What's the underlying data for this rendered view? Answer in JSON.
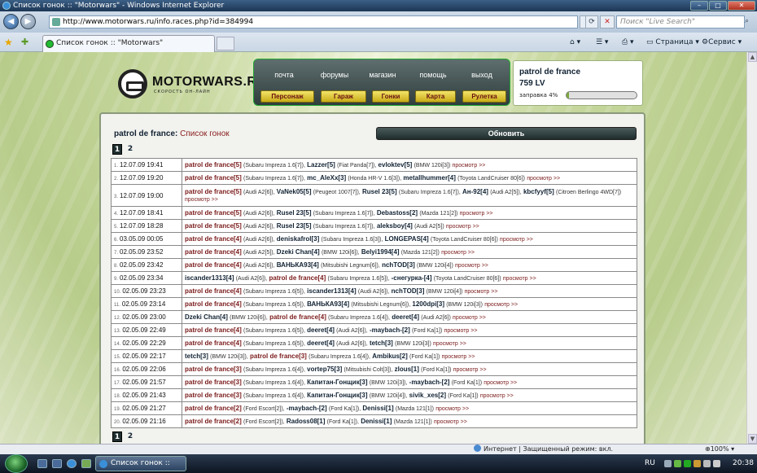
{
  "browser": {
    "window_title": "Список гонок :: \"Motorwars\" - Windows Internet Explorer",
    "url": "http://www.motorwars.ru/info.races.php?id=384994",
    "search_placeholder": "Поиск \"Live Search\"",
    "tab_title": "Список гонок :: \"Motorwars\"",
    "tool_page": "Страница",
    "tool_service": "Сервис",
    "status_zone": "Интернет | Защищенный режим: вкл.",
    "zoom": "100%"
  },
  "taskbar": {
    "task_label": "Список гонок :: \"М...",
    "lang": "RU",
    "clock": "20:38"
  },
  "site": {
    "logo_name": "MOTORWARS.RU",
    "logo_slogan": "СКОРОСТЬ ОН-ЛАЙН",
    "nav_top": [
      "почта",
      "форумы",
      "магазин",
      "помощь",
      "выход"
    ],
    "nav_buttons": [
      "Персонаж",
      "Гараж",
      "Гонки",
      "Карта",
      "Рулетка"
    ],
    "user_name": "patrol de france",
    "user_money": "759 LV",
    "fuel_label": "заправка 4%",
    "fuel_percent": 4,
    "crumb_user": "patrol de france:",
    "crumb_link": "Список гонок",
    "refresh_label": "Обновить",
    "pages": [
      "1",
      "2"
    ],
    "current_page": "1"
  },
  "races": [
    {
      "n": "1.",
      "date": "12.07.09 19:41",
      "p": [
        [
          "patrol de france[5]",
          "(Subaru Impreza 1.6[7]),"
        ],
        [
          "Lazzer[5]",
          "(Fiat Panda[7]),"
        ],
        [
          "evloktev[5]",
          "(BMW 120i[3])"
        ]
      ],
      "view": "просмотр >>"
    },
    {
      "n": "2.",
      "date": "12.07.09 19:20",
      "p": [
        [
          "patrol de france[5]",
          "(Subaru Impreza 1.6[7]),"
        ],
        [
          "mc_AleXx[3]",
          "(Honda HR-V 1.6[3]),"
        ],
        [
          "metallhummer[4]",
          "(Toyota LandCruiser 80[6])"
        ]
      ],
      "view": "просмотр >>"
    },
    {
      "n": "3.",
      "date": "12.07.09 19:00",
      "p": [
        [
          "patrol de france[5]",
          "(Audi A2[6]),"
        ],
        [
          "VaNek05[5]",
          "(Peugeot 1007[7]),"
        ],
        [
          "Rusel 23[5]",
          "(Subaru Impreza 1.6[7]),"
        ],
        [
          "Ан-92[4]",
          "(Audi A2[5]),"
        ],
        [
          "kbcfyyf[5]",
          "(Citroen Berlingo 4WD[7])"
        ]
      ],
      "view": "просмотр >>"
    },
    {
      "n": "4.",
      "date": "12.07.09 18:41",
      "p": [
        [
          "patrol de france[5]",
          "(Audi A2[6]),"
        ],
        [
          "Rusel 23[5]",
          "(Subaru Impreza 1.6[7]),"
        ],
        [
          "Debastoss[2]",
          "(Mazda 121[2])"
        ]
      ],
      "view": "просмотр >>"
    },
    {
      "n": "5.",
      "date": "12.07.09 18:28",
      "p": [
        [
          "patrol de france[5]",
          "(Audi A2[6]),"
        ],
        [
          "Rusel 23[5]",
          "(Subaru Impreza 1.6[7]),"
        ],
        [
          "aleksboy[4]",
          "(Audi A2[5])"
        ]
      ],
      "view": "просмотр >>"
    },
    {
      "n": "6.",
      "date": "03.05.09 00:05",
      "p": [
        [
          "patrol de france[4]",
          "(Audi A2[6]),"
        ],
        [
          "deniskafrol[3]",
          "(Subaru Impreza 1.6[3]),"
        ],
        [
          "LONGEPAS[4]",
          "(Toyota LandCruiser 80[6])"
        ]
      ],
      "view": "просмотр >>"
    },
    {
      "n": "7.",
      "date": "02.05.09 23:52",
      "p": [
        [
          "patrol de france[4]",
          "(Audi A2[5]),"
        ],
        [
          "Dzeki Chan[4]",
          "(BMW 120i[6]),"
        ],
        [
          "Belyi1994[4]",
          "(Mazda 121[2])"
        ]
      ],
      "view": "просмотр >>"
    },
    {
      "n": "8.",
      "date": "02.05.09 23:42",
      "p": [
        [
          "patrol de france[4]",
          "(Audi A2[6]),"
        ],
        [
          "ВАНЬКА93[4]",
          "(Mitsubishi Legnum[6]),"
        ],
        [
          "nchTOD[3]",
          "(BMW 120i[4])"
        ]
      ],
      "view": "просмотр >>"
    },
    {
      "n": "9.",
      "date": "02.05.09 23:34",
      "p": [
        [
          "iscander1313[4]",
          "(Audi A2[6]),"
        ],
        [
          "patrol de france[4]",
          "(Subaru Impreza 1.6[5]),"
        ],
        [
          "-снегурка-[4]",
          "(Toyota LandCruiser 80[6])"
        ]
      ],
      "view": "просмотр >>"
    },
    {
      "n": "10.",
      "date": "02.05.09 23:23",
      "p": [
        [
          "patrol de france[4]",
          "(Subaru Impreza 1.6[5]),"
        ],
        [
          "iscander1313[4]",
          "(Audi A2[6]),"
        ],
        [
          "nchTOD[3]",
          "(BMW 120i[4])"
        ]
      ],
      "view": "просмотр >>"
    },
    {
      "n": "11.",
      "date": "02.05.09 23:14",
      "p": [
        [
          "patrol de france[4]",
          "(Subaru Impreza 1.6[5]),"
        ],
        [
          "ВАНЬКА93[4]",
          "(Mitsubishi Legnum[6]),"
        ],
        [
          "1200dpi[3]",
          "(BMW 120i[3])"
        ]
      ],
      "view": "просмотр >>"
    },
    {
      "n": "12.",
      "date": "02.05.09 23:00",
      "p": [
        [
          "Dzeki Chan[4]",
          "(BMW 120i[6]),"
        ],
        [
          "patrol de france[4]",
          "(Subaru Impreza 1.6[4]),"
        ],
        [
          "deeret[4]",
          "(Audi A2[6])"
        ]
      ],
      "view": "просмотр >>"
    },
    {
      "n": "13.",
      "date": "02.05.09 22:49",
      "p": [
        [
          "patrol de france[4]",
          "(Subaru Impreza 1.6[5]),"
        ],
        [
          "deeret[4]",
          "(Audi A2[6]),"
        ],
        [
          "-maybach-[2]",
          "(Ford Ka[1])"
        ]
      ],
      "view": "просмотр >>"
    },
    {
      "n": "14.",
      "date": "02.05.09 22:29",
      "p": [
        [
          "patrol de france[4]",
          "(Subaru Impreza 1.6[5]),"
        ],
        [
          "deeret[4]",
          "(Audi A2[6]),"
        ],
        [
          "tetch[3]",
          "(BMW 120i[3])"
        ]
      ],
      "view": "просмотр >>"
    },
    {
      "n": "15.",
      "date": "02.05.09 22:17",
      "p": [
        [
          "tetch[3]",
          "(BMW 120i[3]),"
        ],
        [
          "patrol de france[3]",
          "(Subaru Impreza 1.6[4]),"
        ],
        [
          "Ambikus[2]",
          "(Ford Ka[1])"
        ]
      ],
      "view": "просмотр >>"
    },
    {
      "n": "16.",
      "date": "02.05.09 22:06",
      "p": [
        [
          "patrol de france[3]",
          "(Subaru Impreza 1.6[4]),"
        ],
        [
          "vortep75[3]",
          "(Mitsubishi Colt[3]),"
        ],
        [
          "zlous[1]",
          "(Ford Ka[1])"
        ]
      ],
      "view": "просмотр >>"
    },
    {
      "n": "17.",
      "date": "02.05.09 21:57",
      "p": [
        [
          "patrol de france[3]",
          "(Subaru Impreza 1.6[4]),"
        ],
        [
          "Капитан-Гонщик[3]",
          "(BMW 120i[3]),"
        ],
        [
          "-maybach-[2]",
          "(Ford Ka[1])"
        ]
      ],
      "view": "просмотр >>"
    },
    {
      "n": "18.",
      "date": "02.05.09 21:43",
      "p": [
        [
          "patrol de france[3]",
          "(Subaru Impreza 1.6[4]),"
        ],
        [
          "Капитан-Гонщик[3]",
          "(BMW 120i[4]),"
        ],
        [
          "sivik_xes[2]",
          "(Ford Ka[1])"
        ]
      ],
      "view": "просмотр >>"
    },
    {
      "n": "19.",
      "date": "02.05.09 21:27",
      "p": [
        [
          "patrol de france[2]",
          "(Ford Escort[2]),"
        ],
        [
          "-maybach-[2]",
          "(Ford Ka[1]),"
        ],
        [
          "Denissi[1]",
          "(Mazda 121[1])"
        ]
      ],
      "view": "просмотр >>"
    },
    {
      "n": "20.",
      "date": "02.05.09 21:16",
      "p": [
        [
          "patrol de france[2]",
          "(Ford Escort[2]),"
        ],
        [
          "Radoss08[1]",
          "(Ford Ka[1]),"
        ],
        [
          "Denissi[1]",
          "(Mazda 121[1])"
        ]
      ],
      "view": "просмотр >>"
    }
  ],
  "colors": {
    "accent_dark": "#1f2e2e",
    "link_red": "#7a1a1a",
    "button_yellow": "#e4cc3a",
    "bg_green": "#b7cc8a"
  }
}
